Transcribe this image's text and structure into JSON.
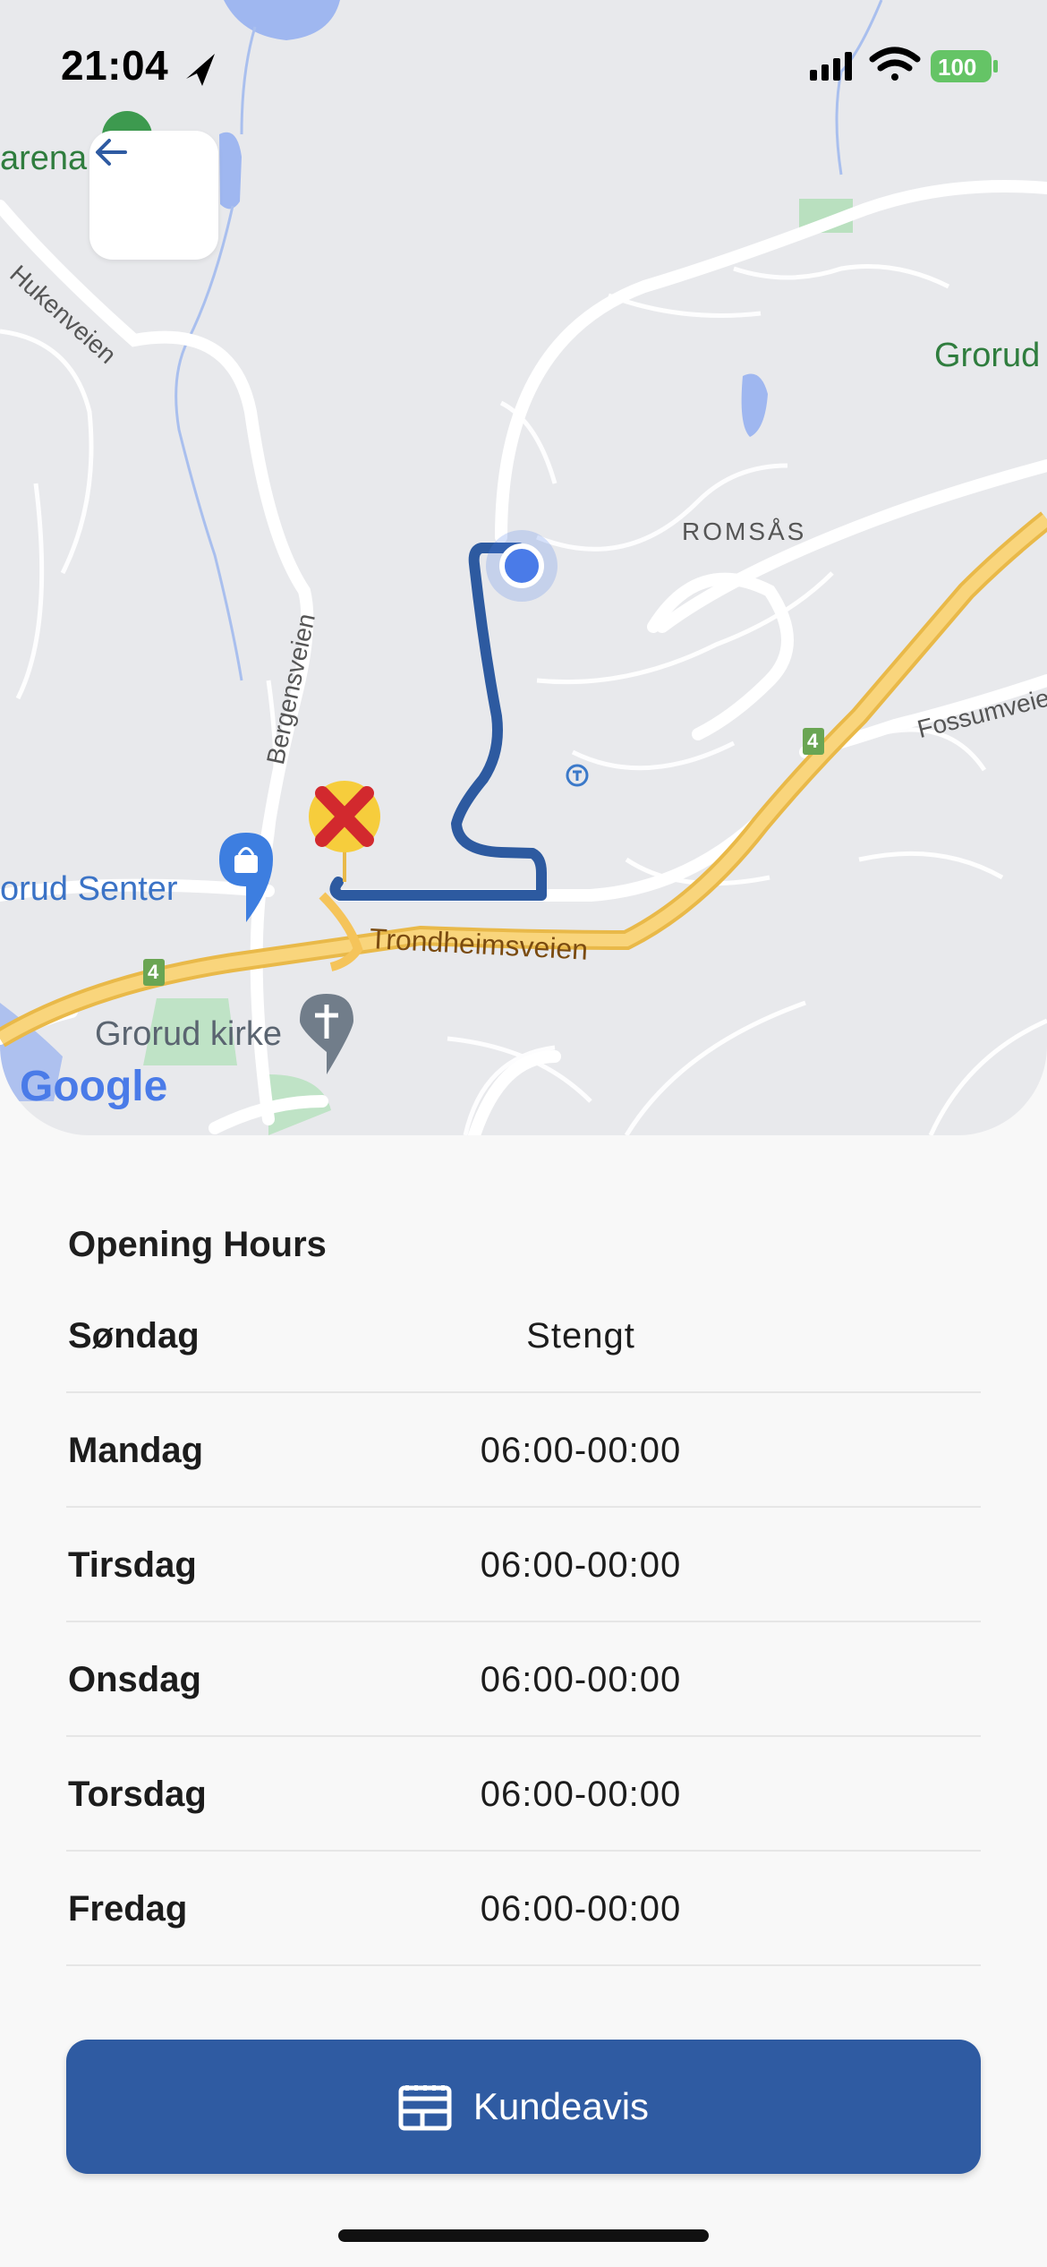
{
  "status_bar": {
    "time": "21:04",
    "battery": "100"
  },
  "map": {
    "labels": {
      "arena": "arena",
      "hukenveien": "Hukenveien",
      "grorud_top": "Grorud",
      "romsas": "ROMSÅS",
      "bergensveien": "Bergensveien",
      "fossumveien": "Fossumveie",
      "grorud_senter": "orud Senter",
      "trondheimsveien": "Trondheimsveien",
      "grorud_kirke": "Grorud kirke",
      "google": "Google",
      "route_4a": "4",
      "route_4b": "4"
    }
  },
  "opening_hours": {
    "title": "Opening Hours",
    "rows": [
      {
        "day": "Søndag",
        "hours": "Stengt"
      },
      {
        "day": "Mandag",
        "hours": "06:00-00:00"
      },
      {
        "day": "Tirsdag",
        "hours": "06:00-00:00"
      },
      {
        "day": "Onsdag",
        "hours": "06:00-00:00"
      },
      {
        "day": "Torsdag",
        "hours": "06:00-00:00"
      },
      {
        "day": "Fredag",
        "hours": "06:00-00:00"
      }
    ]
  },
  "cta": {
    "label": "Kundeavis"
  },
  "colors": {
    "accent": "#2f5ba2",
    "route": "#2d5aa0",
    "highway": "#f5c45a"
  }
}
